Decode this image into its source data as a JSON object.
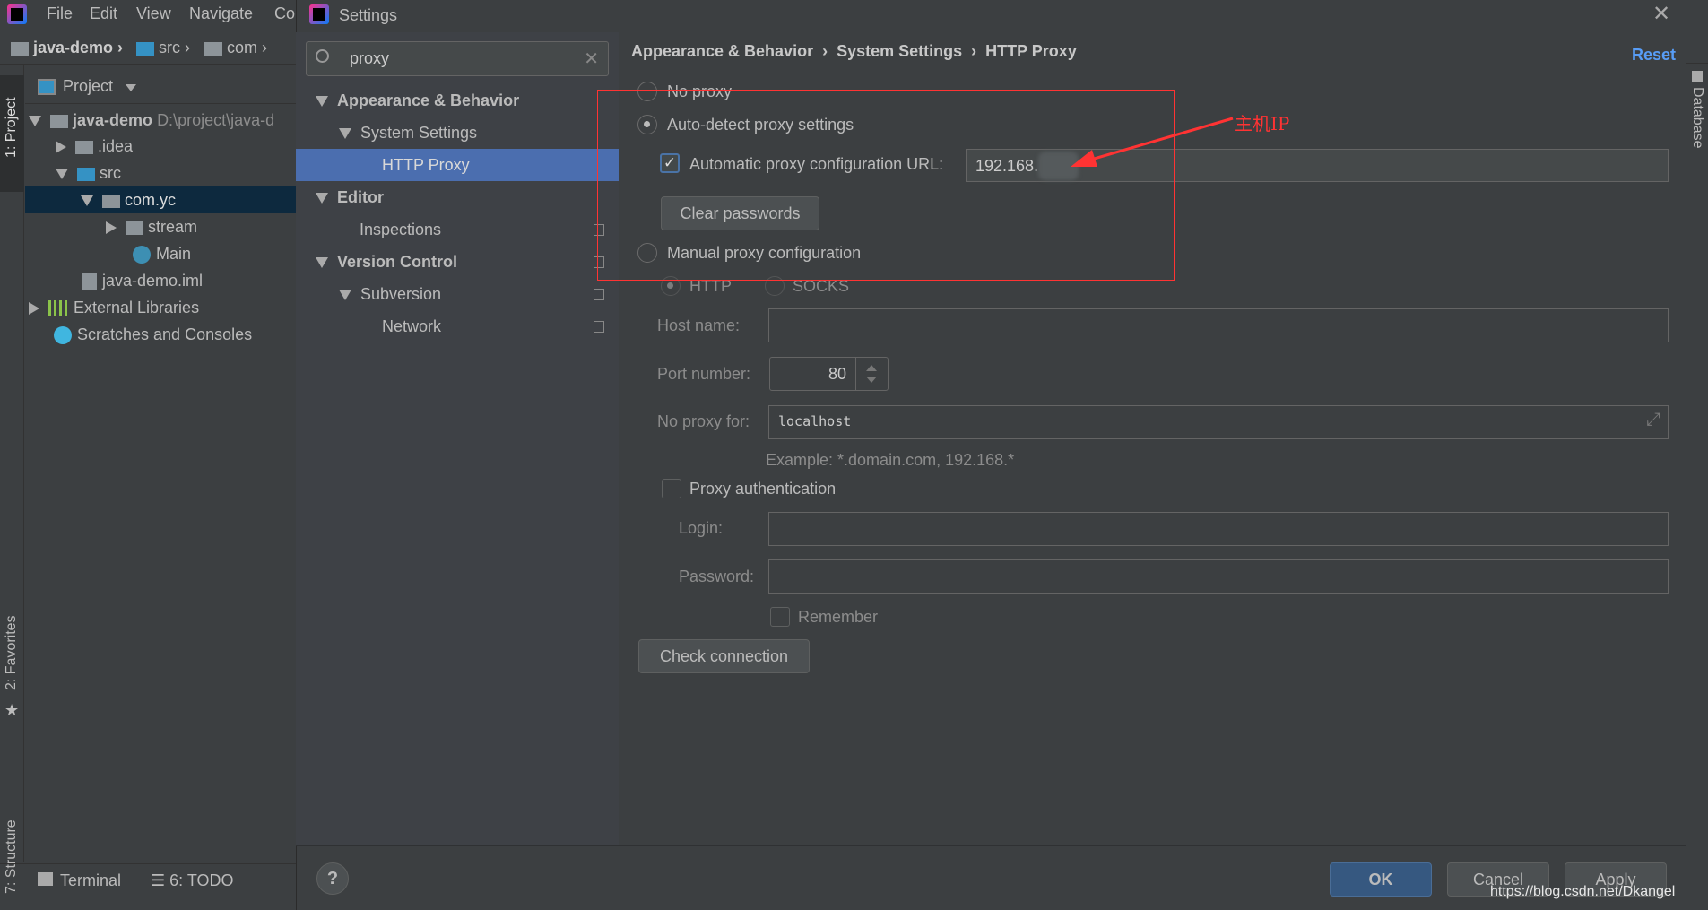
{
  "ide": {
    "menu": [
      "File",
      "Edit",
      "View",
      "Navigate",
      "Co"
    ],
    "breadcrumb": [
      "java-demo",
      "src",
      "com"
    ],
    "tool_windows": {
      "project": "1: Project",
      "favorites": "2: Favorites",
      "structure": "7: Structure",
      "database": "Database"
    },
    "project_header": "Project",
    "tree": [
      {
        "label": "java-demo",
        "extra": "D:\\project\\java-d"
      },
      {
        "label": ".idea"
      },
      {
        "label": "src"
      },
      {
        "label": "com.yc"
      },
      {
        "label": "stream"
      },
      {
        "label": "Main"
      },
      {
        "label": "java-demo.iml"
      },
      {
        "label": "External Libraries"
      },
      {
        "label": "Scratches and Consoles"
      }
    ],
    "bottom": {
      "terminal": "Terminal",
      "todo": "6: TODO"
    }
  },
  "dialog": {
    "title": "Settings",
    "search": {
      "value": "proxy"
    },
    "tree": [
      {
        "label": "Appearance & Behavior",
        "bold": true
      },
      {
        "label": "System Settings"
      },
      {
        "label": "HTTP Proxy",
        "selected": true
      },
      {
        "label": "Editor",
        "bold": true
      },
      {
        "label": "Inspections"
      },
      {
        "label": "Version Control",
        "bold": true
      },
      {
        "label": "Subversion"
      },
      {
        "label": "Network"
      }
    ],
    "breadcrumb": [
      "Appearance & Behavior",
      "System Settings",
      "HTTP Proxy"
    ],
    "reset": "Reset",
    "no_proxy": "No proxy",
    "auto_detect": "Auto-detect proxy settings",
    "auto_url_label": "Automatic proxy configuration URL:",
    "auto_url_value": "192.168.",
    "clear_passwords": "Clear passwords",
    "manual": "Manual proxy configuration",
    "http": "HTTP",
    "socks": "SOCKS",
    "host_label": "Host name:",
    "port_label": "Port number:",
    "port_value": "80",
    "no_proxy_for_label": "No proxy for:",
    "no_proxy_for_value": "localhost",
    "example": "Example: *.domain.com, 192.168.*",
    "proxy_auth": "Proxy authentication",
    "login_label": "Login:",
    "password_label": "Password:",
    "remember": "Remember",
    "check_connection": "Check connection",
    "ok": "OK",
    "cancel": "Cancel",
    "apply": "Apply",
    "help": "?"
  },
  "annotation": {
    "label": "主机IP",
    "color": "#ff3333"
  },
  "watermark": "https://blog.csdn.net/Dkangel",
  "colors": {
    "accent": "#4b6eaf",
    "ok_button": "#365880",
    "link": "#589df6"
  }
}
